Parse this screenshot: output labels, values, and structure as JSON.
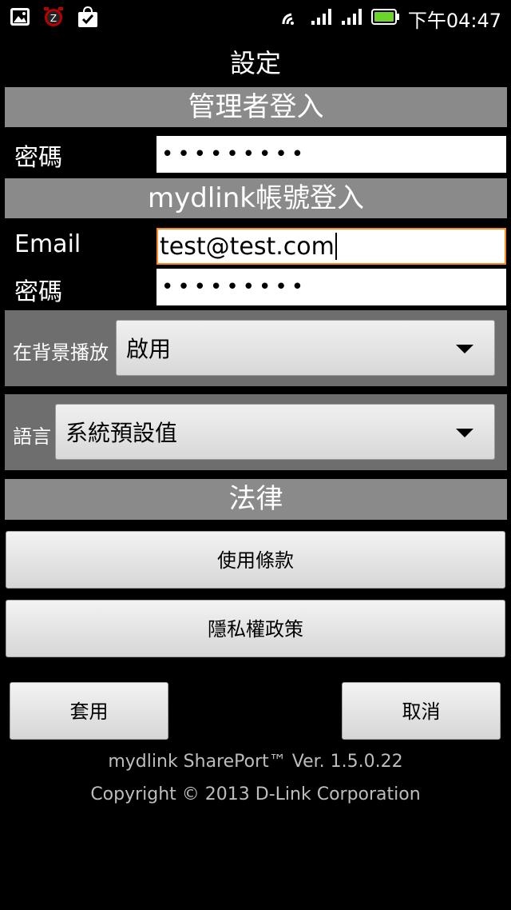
{
  "status_bar": {
    "time": "下午04:47",
    "icons": [
      "gallery-icon",
      "alarm-icon",
      "store-bag-icon",
      "wifi-icon",
      "signal-icon",
      "signal-icon",
      "battery-icon"
    ]
  },
  "title": "設定",
  "admin_section": {
    "header": "管理者登入",
    "password_label": "密碼",
    "password_value": "•••••••••"
  },
  "mydlink_section": {
    "header": "mydlink帳號登入",
    "email_label": "Email",
    "email_value": "test@test.com",
    "password_label": "密碼",
    "password_value": "•••••••••"
  },
  "background_play": {
    "label": "在背景播放",
    "selected": "啟用"
  },
  "language": {
    "label": "語言",
    "selected": "系統預設值"
  },
  "legal": {
    "header": "法律",
    "terms_label": "使用條款",
    "privacy_label": "隱私權政策"
  },
  "actions": {
    "apply_label": "套用",
    "cancel_label": "取消"
  },
  "footer": {
    "version": "mydlink SharePort™ Ver. 1.5.0.22",
    "copyright": "Copyright © 2013 D-Link Corporation"
  },
  "colors": {
    "section_header": "#8a8a8a",
    "panel": "#6e6e6e",
    "focus_border": "#ff8a1a",
    "battery_green": "#6bd32a"
  }
}
